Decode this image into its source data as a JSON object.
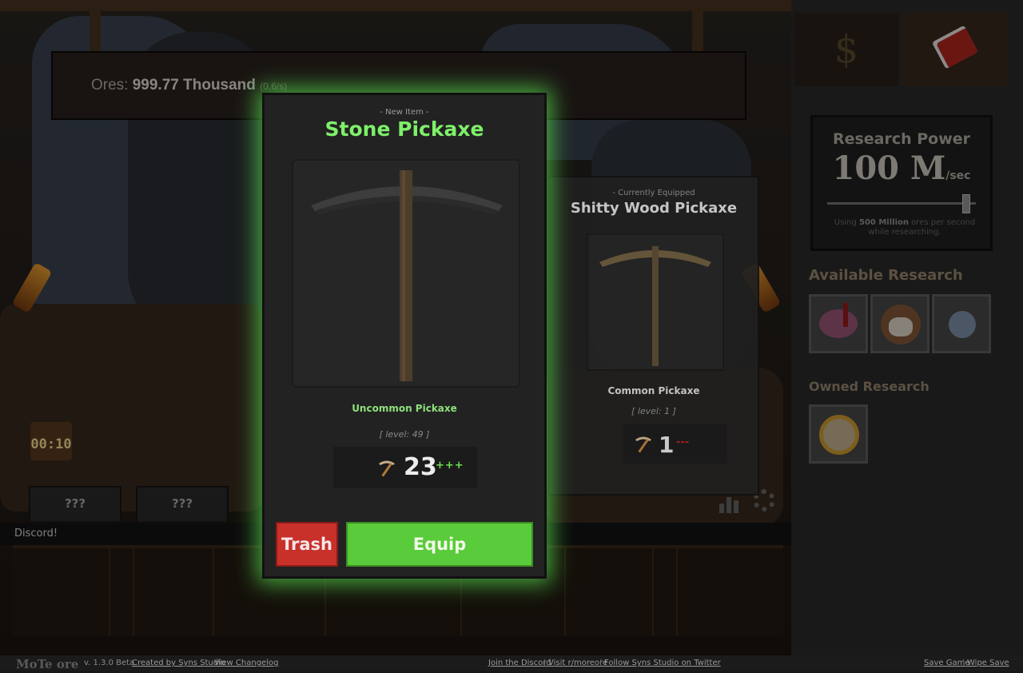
{
  "header": {
    "ores_label": "Ores:",
    "ores_value": "999.77 Thousand",
    "ores_rate": "(0.6/s)"
  },
  "gift": {
    "timer": "00:10"
  },
  "tabs": [
    "???",
    "???"
  ],
  "chat": {
    "message": "Discord!"
  },
  "right_panel": {
    "money_icon": "$",
    "research_power": {
      "title": "Research Power",
      "value": "100 M",
      "unit": "/sec",
      "note_prefix": "Using",
      "note_amount": "500 Million",
      "note_suffix": "ores per second while researching.",
      "slider_level": 0.95
    },
    "available_title": "Available Research",
    "owned_title": "Owned Research"
  },
  "new_item": {
    "caption": "- New Item -",
    "name": "Stone Pickaxe",
    "rarity": "Uncommon Pickaxe",
    "level": "[ level: 49 ]",
    "stat": "23",
    "stat_modifier": "+++",
    "trash_label": "Trash",
    "equip_label": "Equip"
  },
  "equipped_item": {
    "caption": "- Currently Equipped",
    "name": "Shitty Wood Pickaxe",
    "rarity": "Common Pickaxe",
    "level": "[ level: 1 ]",
    "stat": "1",
    "stat_modifier": "---"
  },
  "footer": {
    "logo": "MoTe ore",
    "version": "v. 1.3.0 Beta",
    "created_by": "Created by Syns Studio",
    "changelog": "View Changelog",
    "discord": "Join the Discord",
    "reddit": "Visit r/moreore",
    "twitter": "Follow Syns Studio on Twitter",
    "save": "Save Game",
    "wipe": "Wipe Save",
    "separator": "|"
  },
  "colors": {
    "new_item_name": "#7ef06a",
    "glow": "#5adc50",
    "trash": "#c8302a",
    "equip": "#5acb3a"
  }
}
